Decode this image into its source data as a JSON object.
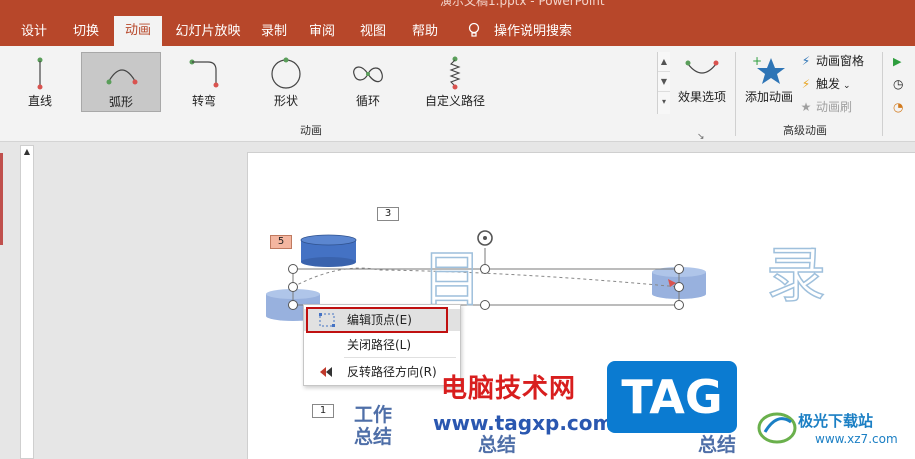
{
  "window": {
    "title": "演示文稿1.pptx - PowerPoint"
  },
  "tabs": [
    "设计",
    "切换",
    "动画",
    "幻灯片放映",
    "录制",
    "审阅",
    "视图",
    "帮助",
    "操作说明搜索"
  ],
  "active_tab": "动画",
  "gallery": {
    "items": [
      {
        "label": "直线",
        "icon": "line-path-icon"
      },
      {
        "label": "弧形",
        "icon": "arc-path-icon",
        "selected": true
      },
      {
        "label": "转弯",
        "icon": "turn-path-icon"
      },
      {
        "label": "形状",
        "icon": "shape-path-icon"
      },
      {
        "label": "循环",
        "icon": "loop-path-icon"
      },
      {
        "label": "自定义路径",
        "icon": "custom-path-icon"
      }
    ],
    "group_label": "动画"
  },
  "effects": {
    "label": "效果选项"
  },
  "advanced": {
    "add_animation": "添加动画",
    "animation_pane": "动画窗格",
    "trigger": "触发",
    "animation_painter": "动画刷",
    "group_label": "高级动画"
  },
  "slide": {
    "tags": {
      "t3": "3",
      "t5": "5",
      "t1": "1"
    },
    "chars": {
      "mu": "目",
      "lu": "录"
    },
    "words": {
      "w1a": "工作",
      "w1b": "总结",
      "w2": "总结",
      "w3a": "工作",
      "w3b": "总结"
    }
  },
  "context_menu": {
    "items": [
      {
        "label": "编辑顶点(E)",
        "icon": "edit-points-icon"
      },
      {
        "label": "关闭路径(L)",
        "icon": ""
      },
      {
        "label": "反转路径方向(R)",
        "icon": "reverse-path-icon"
      }
    ]
  },
  "watermark": {
    "cn": "电脑技术网",
    "url": "www.tagxp.com",
    "tag": "TAG",
    "site_cn": "极光下载站",
    "site_url": "www.xz7.com"
  },
  "colors": {
    "accent": "#b7472a",
    "highlight_box": "#c01010",
    "cylinder": "#4472c4"
  }
}
